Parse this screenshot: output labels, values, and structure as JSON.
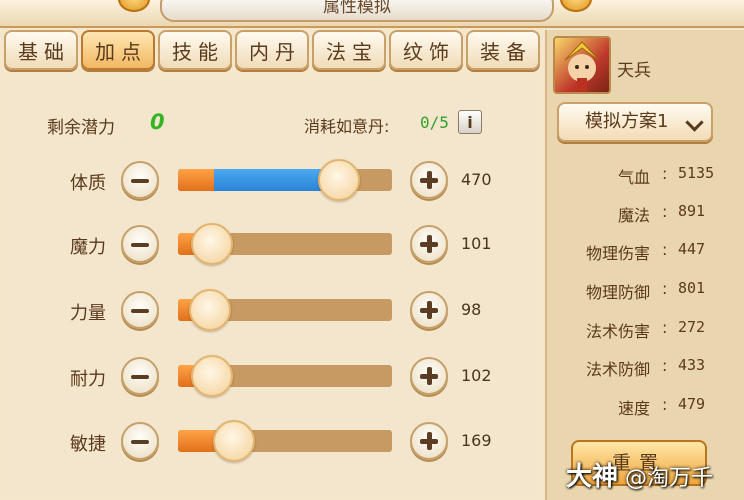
{
  "header": {
    "title": "属性模拟"
  },
  "tabs": [
    {
      "label": "基础",
      "active": false
    },
    {
      "label": "加点",
      "active": true
    },
    {
      "label": "技能",
      "active": false
    },
    {
      "label": "内丹",
      "active": false
    },
    {
      "label": "法宝",
      "active": false
    },
    {
      "label": "纹饰",
      "active": false
    },
    {
      "label": "装备",
      "active": false
    }
  ],
  "points": {
    "remaining_label": "剩余潜力",
    "remaining_value": "0",
    "consume_label": "消耗如意丹:",
    "consume_value": "0/5",
    "info_icon": "i"
  },
  "attributes": [
    {
      "label": "体质",
      "value": "470",
      "level": 0.75,
      "extra_blue": true
    },
    {
      "label": "魔力",
      "value": "101",
      "level": 0.16,
      "extra_blue": false
    },
    {
      "label": "力量",
      "value": "98",
      "level": 0.15,
      "extra_blue": false
    },
    {
      "label": "耐力",
      "value": "102",
      "level": 0.16,
      "extra_blue": false
    },
    {
      "label": "敏捷",
      "value": "169",
      "level": 0.26,
      "extra_blue": false
    }
  ],
  "character": {
    "name": "天兵",
    "scheme_label": "模拟方案1"
  },
  "stats": [
    {
      "label": "气血",
      "value": "5135"
    },
    {
      "label": "魔法",
      "value": "891"
    },
    {
      "label": "物理伤害",
      "value": "447"
    },
    {
      "label": "物理防御",
      "value": "801"
    },
    {
      "label": "法术伤害",
      "value": "272"
    },
    {
      "label": "法术防御",
      "value": "433"
    },
    {
      "label": "速度",
      "value": "479"
    }
  ],
  "reset_label": "重置",
  "watermark": {
    "brand": "大神",
    "handle": "@淘万千"
  },
  "colors": {
    "accent_green": "#35b526",
    "fill_blue": "#2c83d6",
    "fill_orange": "#e0701a"
  }
}
